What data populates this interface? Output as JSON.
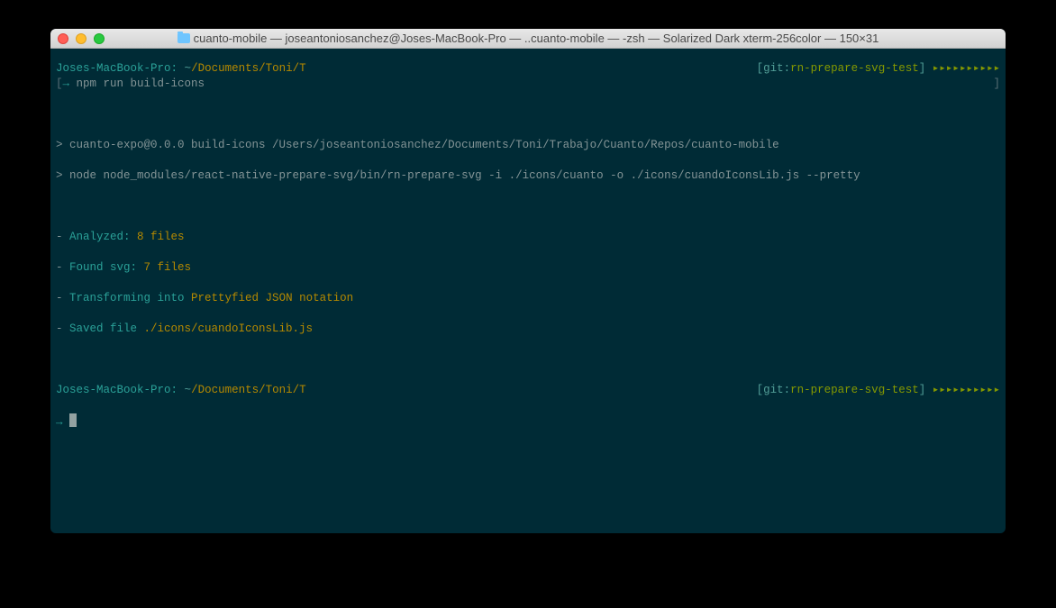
{
  "window": {
    "title": "cuanto-mobile — joseantoniosanchez@Joses-MacBook-Pro — ..cuanto-mobile — -zsh — Solarized Dark xterm-256color — 150×31"
  },
  "prompt1": {
    "host": "Joses-MacBook-Pro:",
    "tilde": "~",
    "path": "/Documents/Toni/T",
    "git_left": "[git:",
    "git_branch": "rn-prepare-svg-test",
    "git_right": "]",
    "arrows": "▸▸▸▸▸▸▸▸▸▸"
  },
  "cmd1": {
    "bracket": "[",
    "arrow": "→ ",
    "text": "npm run build-icons",
    "rbracket": "]"
  },
  "out1": "> cuanto-expo@0.0.0 build-icons /Users/joseantoniosanchez/Documents/Toni/Trabajo/Cuanto/Repos/cuanto-mobile",
  "out2": "> node node_modules/react-native-prepare-svg/bin/rn-prepare-svg -i ./icons/cuanto -o ./icons/cuandoIconsLib.js --pretty",
  "line1": {
    "dash": "- ",
    "label": "Analyzed: ",
    "val": "8 files"
  },
  "line2": {
    "dash": "- ",
    "label": "Found svg: ",
    "val": "7 files"
  },
  "line3": {
    "dash": "- ",
    "label": "Transforming into ",
    "val": "Prettyfied JSON notation"
  },
  "line4": {
    "dash": "- ",
    "label": "Saved file ",
    "val": "./icons/cuandoIconsLib.js"
  },
  "prompt2": {
    "host": "Joses-MacBook-Pro:",
    "tilde": "~",
    "path": "/Documents/Toni/T",
    "git_left": "[git:",
    "git_branch": "rn-prepare-svg-test",
    "git_right": "]",
    "arrows": "▸▸▸▸▸▸▸▸▸▸"
  },
  "cmd2": {
    "arrow": "→ "
  }
}
